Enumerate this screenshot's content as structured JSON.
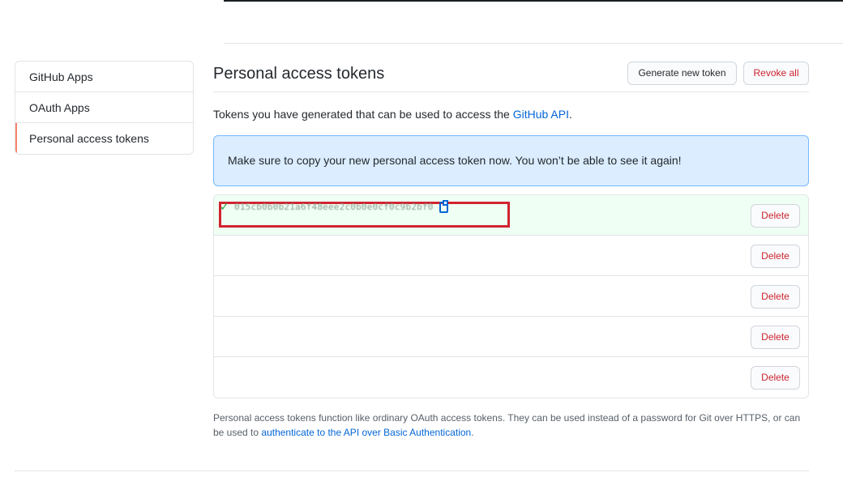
{
  "sidebar": {
    "items": [
      {
        "label": "GitHub Apps"
      },
      {
        "label": "OAuth Apps"
      },
      {
        "label": "Personal access tokens"
      }
    ]
  },
  "header": {
    "title": "Personal access tokens",
    "generate_label": "Generate new token",
    "revoke_label": "Revoke all"
  },
  "description": {
    "text": "Tokens you have generated that can be used to access the ",
    "link": "GitHub API",
    "suffix": "."
  },
  "flash": {
    "message": "Make sure to copy your new personal access token now. You won’t be able to see it again!"
  },
  "tokens": {
    "new_token_value": "015cb0b0b21a6f48eee2c0b0e0cf0c9b2bf0",
    "delete_label": "Delete",
    "rows": 5
  },
  "footnote": {
    "text": "Personal access tokens function like ordinary OAuth access tokens. They can be used instead of a password for Git over HTTPS, or can be used to ",
    "link": "authenticate to the API over Basic Authentication",
    "suffix": "."
  },
  "colors": {
    "link": "#0366d6",
    "danger": "#cb2431",
    "success": "#28a745",
    "flash_bg": "#dbedff",
    "highlight": "#d1242f"
  }
}
